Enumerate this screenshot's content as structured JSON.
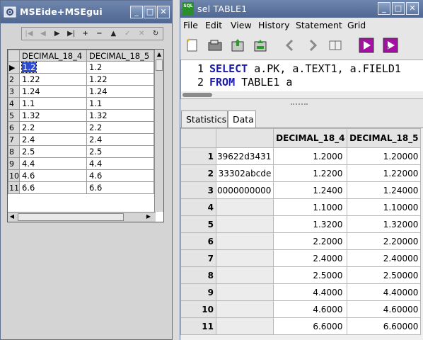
{
  "left_window": {
    "title": "MSEide+MSEgui",
    "nav_buttons": [
      "|◀",
      "◀",
      "▶",
      "▶|",
      "+",
      "−",
      "▲",
      "✓",
      "✕",
      "↻"
    ],
    "grid": {
      "columns": [
        "DECIMAL_18_4",
        "DECIMAL_18_5"
      ],
      "rows": [
        {
          "n": "1",
          "a": "1.2",
          "b": "1.2"
        },
        {
          "n": "2",
          "a": "1.22",
          "b": "1.22"
        },
        {
          "n": "3",
          "a": "1.24",
          "b": "1.24"
        },
        {
          "n": "4",
          "a": "1.1",
          "b": "1.1"
        },
        {
          "n": "5",
          "a": "1.32",
          "b": "1.32"
        },
        {
          "n": "6",
          "a": "2.2",
          "b": "2.2"
        },
        {
          "n": "7",
          "a": "2.4",
          "b": "2.4"
        },
        {
          "n": "8",
          "a": "2.5",
          "b": "2.5"
        },
        {
          "n": "9",
          "a": "4.4",
          "b": "4.4"
        },
        {
          "n": "10",
          "a": "4.6",
          "b": "4.6"
        },
        {
          "n": "11",
          "a": "6.6",
          "b": "6.6"
        }
      ]
    }
  },
  "right_window": {
    "title": "sel TABLE1",
    "icon_text": "SQL",
    "menu": [
      "File",
      "Edit",
      "View",
      "History",
      "Statement",
      "Grid"
    ],
    "editor_lines": [
      {
        "n": "1",
        "kw": "SELECT",
        "rest": " a.PK, a.TEXT1, a.FIELD1"
      },
      {
        "n": "2",
        "kw": "FROM",
        "rest": " TABLE1 a"
      }
    ],
    "tabs": [
      "Statistics",
      "Data"
    ],
    "grid": {
      "columns": [
        "",
        "DECIMAL_18_4",
        "DECIMAL_18_5"
      ],
      "rows": [
        {
          "n": "1",
          "pk": "39622d3431",
          "a": "1.2000",
          "b": "1.20000"
        },
        {
          "n": "2",
          "pk": "33302abcde",
          "a": "1.2200",
          "b": "1.22000"
        },
        {
          "n": "3",
          "pk": "0000000000",
          "a": "1.2400",
          "b": "1.24000"
        },
        {
          "n": "4",
          "pk": "",
          "a": "1.1000",
          "b": "1.10000"
        },
        {
          "n": "5",
          "pk": "",
          "a": "1.3200",
          "b": "1.32000"
        },
        {
          "n": "6",
          "pk": "",
          "a": "2.2000",
          "b": "2.20000"
        },
        {
          "n": "7",
          "pk": "",
          "a": "2.4000",
          "b": "2.40000"
        },
        {
          "n": "8",
          "pk": "",
          "a": "2.5000",
          "b": "2.50000"
        },
        {
          "n": "9",
          "pk": "",
          "a": "4.4000",
          "b": "4.40000"
        },
        {
          "n": "10",
          "pk": "",
          "a": "4.6000",
          "b": "4.60000"
        },
        {
          "n": "11",
          "pk": "",
          "a": "6.6000",
          "b": "6.60000"
        }
      ]
    }
  },
  "window_buttons": {
    "minimize": "_",
    "maximize": "□",
    "close": "✕"
  }
}
